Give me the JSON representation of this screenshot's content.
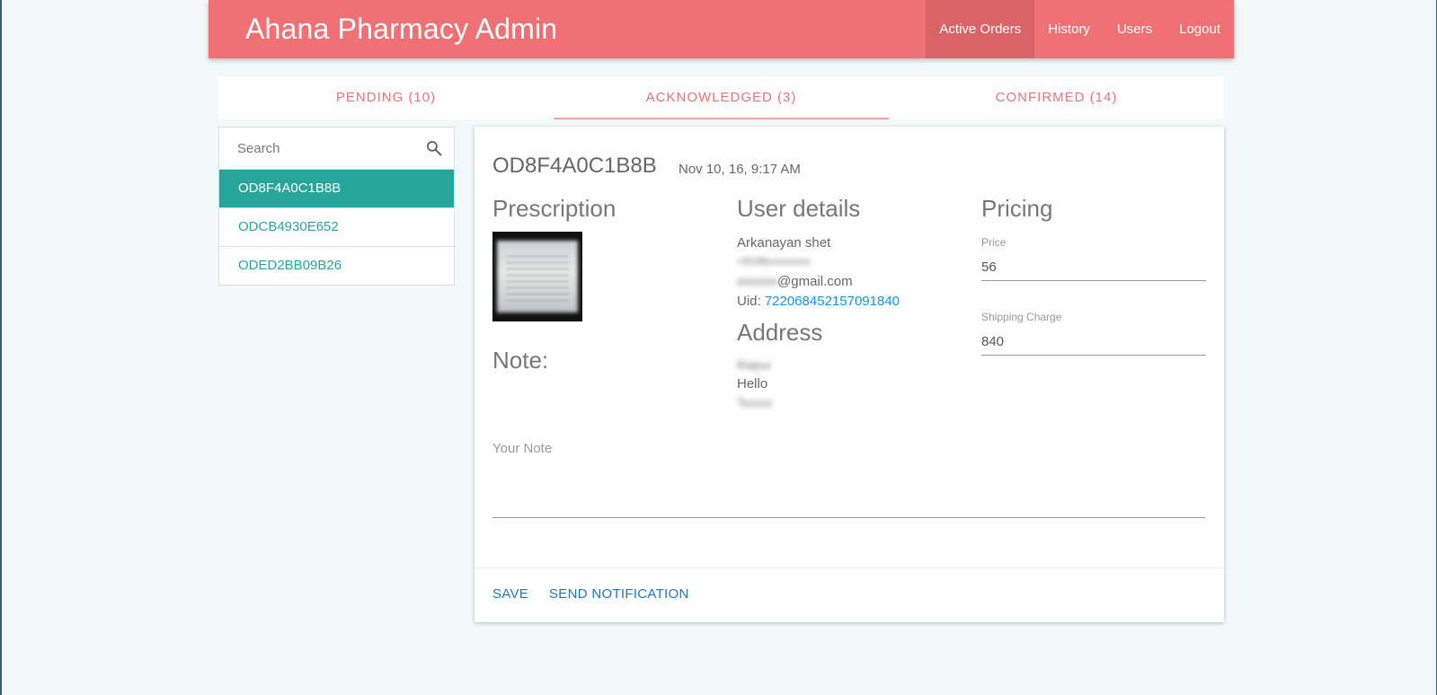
{
  "header": {
    "title": "Ahana Pharmacy Admin",
    "nav": [
      "Active Orders",
      "History",
      "Users",
      "Logout"
    ]
  },
  "tabs": [
    "PENDING (10)",
    "ACKNOWLEDGED (3)",
    "CONFIRMED (14)"
  ],
  "sidebar": {
    "search_placeholder": "Search",
    "orders": [
      "OD8F4A0C1B8B",
      "ODCB4930E652",
      "ODED2BB09B26"
    ]
  },
  "order": {
    "id": "OD8F4A0C1B8B",
    "date": "Nov 10, 16, 9:17 AM",
    "prescription_title": "Prescription",
    "note_title": "Note:",
    "user_details_title": "User details",
    "user_name": "Arkanayan shet",
    "phone": "+9198xxxxxxxx",
    "email_prefix": "xxxxxx",
    "email_suffix": "@gmail.com",
    "uid_label": "Uid: ",
    "uid": "722068452157091840",
    "address_title": "Address",
    "address_line1": "Raipur",
    "address_line2": "Hello",
    "address_line3": "Tsxxxx",
    "pricing_title": "Pricing",
    "price_label": "Price",
    "price_value": "56",
    "shipping_label": "Shipping Charge",
    "shipping_value": "840",
    "note_placeholder": "Your Note",
    "save_label": "SAVE",
    "notify_label": "SEND NOTIFICATION"
  },
  "colors": {
    "header_bg": "#f07074",
    "accent_teal": "#26a69a",
    "link_blue": "#1976d2"
  }
}
